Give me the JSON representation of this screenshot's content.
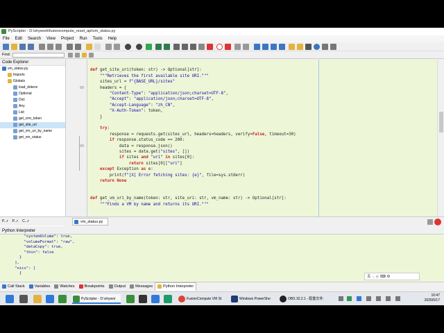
{
  "window": {
    "title": "PyScripter - D:\\shywork\\fusioncompute_reset_api\\vm_status.py"
  },
  "menu": [
    "File",
    "Edit",
    "Search",
    "View",
    "Project",
    "Run",
    "Tools",
    "Help"
  ],
  "find": {
    "label": "Find:"
  },
  "explorer": {
    "title": "Code Explorer",
    "items": [
      {
        "label": "vm_status.py",
        "indent": 0
      },
      {
        "label": "Imports",
        "indent": 1
      },
      {
        "label": "Globals",
        "indent": 1
      },
      {
        "label": "load_dotenv",
        "indent": 2
      },
      {
        "label": "Optional",
        "indent": 2
      },
      {
        "label": "Dict",
        "indent": 2
      },
      {
        "label": "Any",
        "indent": 2
      },
      {
        "label": "List",
        "indent": 2
      },
      {
        "label": "get_vrm_token",
        "indent": 2
      },
      {
        "label": "get_site_uri",
        "indent": 2,
        "selected": true
      },
      {
        "label": "get_vm_uri_by_name",
        "indent": 2
      },
      {
        "label": "get_vm_status",
        "indent": 2
      }
    ],
    "tabs": [
      "P...r",
      "P...r",
      "C...r"
    ]
  },
  "editor": {
    "line_numbers": [
      "80",
      "90"
    ],
    "lines": [
      "",
      "def get_site_uri(token: str) -> Optional[str]:",
      "    \"\"\"Retrieves the first available site URI.\"\"\"",
      "    sites_url = f\"{BASE_URL}/sites\"",
      "    headers = {",
      "        \"Content-Type\": \"application/json;charset=UTF-8\",",
      "        \"Accept\": \"application/json;charset=UTF-8\",",
      "        \"Accept-Language\": \"zh_CN\",",
      "        \"X-Auth-Token\": token,",
      "    }",
      "",
      "    try:",
      "        response = requests.get(sites_url, headers=headers, verify=False, timeout=30)",
      "        if response.status_code == 200:",
      "            data = response.json()",
      "            sites = data.get(\"sites\", [])",
      "            if sites and \"uri\" in sites[0]:",
      "                return sites[0][\"uri\"]",
      "    except Exception as e:",
      "        print(f\"[X] Error fetching sites: {e}\", file=sys.stderr)",
      "    return None",
      "",
      "",
      "def get_vm_uri_by_name(token: str, site_uri: str, vm_name: str) -> Optional[str]:",
      "    \"\"\"Finds a VM by name and returns its URI.\"\"\""
    ],
    "file_tab": "vm_status.py"
  },
  "interpreter": {
    "title": "Python Interpreter",
    "lines": [
      "        \"systemVolume\": true,",
      "        \"volumeFormat\": \"raw\",",
      "        \"dataCopy\": true,",
      "        \"thin\": false",
      "      }",
      "    ],",
      "    \"nics\": [",
      "      {"
    ]
  },
  "bottom_tabs": [
    "Call Stack",
    "Variables",
    "Watches",
    "Breakpoints",
    "Output",
    "Messages",
    "Python Interpreter"
  ],
  "ime": {
    "label": "五 ·, ☺ ⌨ ⚙"
  },
  "taskbar": {
    "apps": [
      {
        "label": "PyScripter - D:\\shywor"
      },
      {
        "label": "FusionCompute VM St"
      },
      {
        "label": "Windows PowerShe"
      },
      {
        "label": "OBS 32.2.1 - 配置文件:"
      }
    ],
    "time": "10:47",
    "date": "2026/5/17"
  },
  "colors": {
    "editor_bg": "#edf7d8",
    "keyword": "#cc2222",
    "string": "#2200aa"
  }
}
